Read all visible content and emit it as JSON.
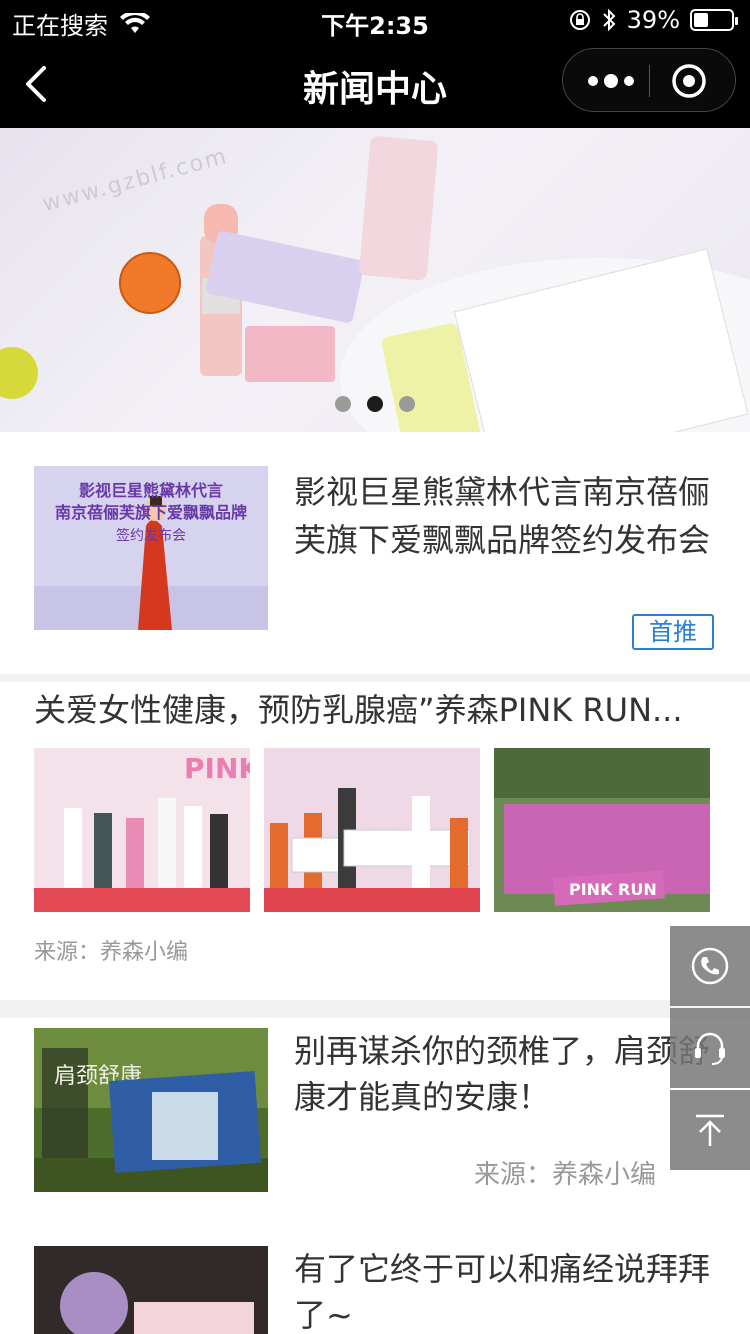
{
  "status_bar": {
    "carrier_text": "正在搜索",
    "time": "下午2:35",
    "battery": "39%",
    "battery_level": 0.39,
    "icons": [
      "wifi-icon",
      "lock-rotation-icon",
      "bluetooth-icon",
      "battery-icon"
    ]
  },
  "nav": {
    "title": "新闻中心",
    "icons": [
      "back-arrow-icon",
      "more-dots-icon",
      "close-target-icon"
    ]
  },
  "banner": {
    "watermark": "www.gzblf.com",
    "slide_count": 3,
    "active_index": 1
  },
  "news": [
    {
      "title": "影视巨星熊黛林代言南京蓓俪芙旗下爱飘飘品牌签约发布会",
      "badge": "首推",
      "image_text": {
        "line1": "影视巨星熊黛林代言",
        "line2": "南京蓓俪芙旗下爱飘飘品牌",
        "line3": "签约发布会"
      }
    },
    {
      "title": "关爱女性健康，预防乳腺癌”养森PINK RUN...",
      "source": "来源：养森小编",
      "gallery_text": [
        "PINK",
        "",
        "PINK RUN"
      ]
    },
    {
      "title": "别再谋杀你的颈椎了，肩颈舒康才能真的安康！",
      "source": "来源：养森小编",
      "image_text": "肩颈舒康"
    },
    {
      "title": "有了它终于可以和痛经说拜拜了~"
    }
  ],
  "side_tools": [
    "phone-icon",
    "headset-icon",
    "back-to-top-icon"
  ],
  "colors": {
    "badge": "#2a7ed8",
    "nav_bg": "#000000",
    "divider": "#f2f2f2"
  }
}
